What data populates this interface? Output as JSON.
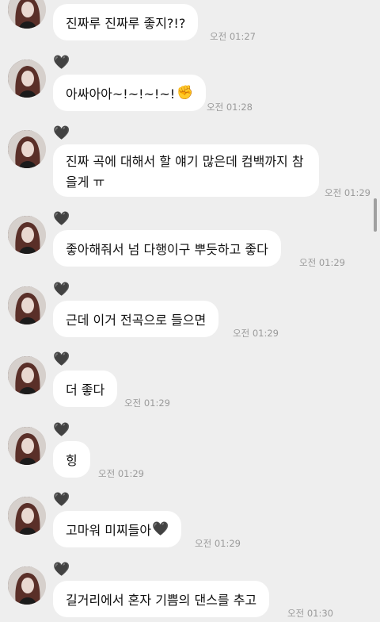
{
  "messages": [
    {
      "text": "진짜루 진짜루 좋지?!?",
      "time": "오전 01:27"
    },
    {
      "text": "아싸아아~!~!~!~!",
      "emoji": "✊",
      "time": "오전 01:28"
    },
    {
      "text": " 진짜 곡에 대해서 할 얘기 많은데 컴백까지 참을게 ㅠ",
      "time": "오전 01:29"
    },
    {
      "text": "좋아해줘서 넘 다행이구 뿌듯하고 좋다",
      "time": "오전 01:29"
    },
    {
      "text": "근데 이거 전곡으로 들으면",
      "time": "오전 01:29"
    },
    {
      "text": "더 좋다",
      "time": "오전 01:29"
    },
    {
      "text": "힝",
      "time": "오전 01:29"
    },
    {
      "text": "고마워 미찌들아",
      "emoji": "🖤",
      "time": "오전 01:29"
    },
    {
      "text": "길거리에서 혼자 기쁨의 댄스를 추고",
      "time": "오전 01:30"
    }
  ],
  "heart_glyph": "🖤",
  "icons": [
    "avatar",
    "black-heart-icon",
    "raised-fist-icon"
  ]
}
